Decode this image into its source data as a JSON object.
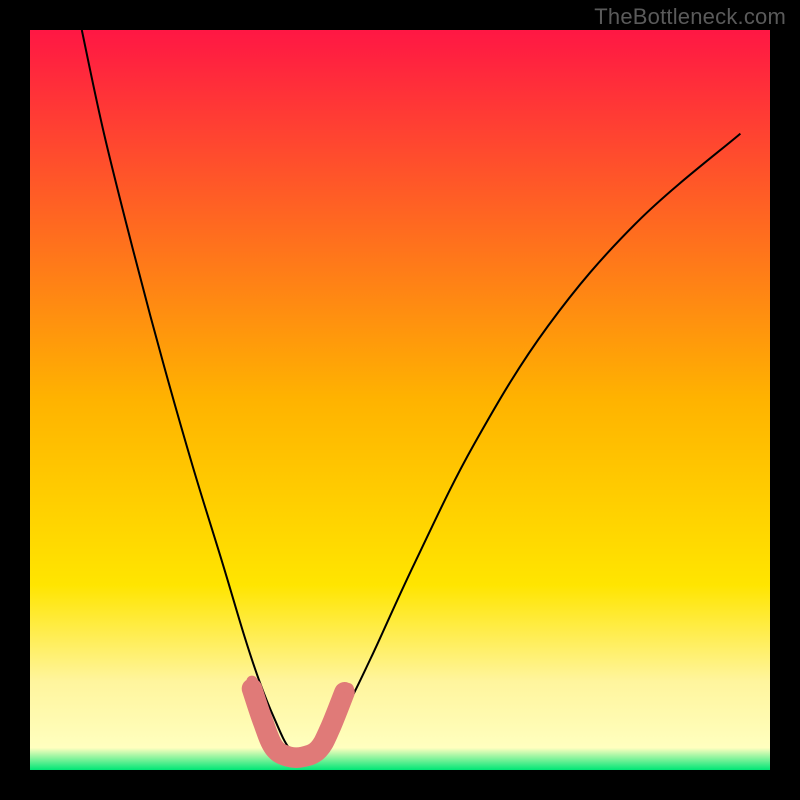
{
  "watermark": "TheBottleneck.com",
  "chart_data": {
    "type": "line",
    "title": "",
    "xlabel": "",
    "ylabel": "",
    "xlim": [
      0,
      100
    ],
    "ylim": [
      0,
      100
    ],
    "grid": false,
    "legend": false,
    "background": {
      "type": "vertical-gradient",
      "stops": [
        {
          "pos": 0.0,
          "color": "#ff1744"
        },
        {
          "pos": 0.5,
          "color": "#ffb300"
        },
        {
          "pos": 0.75,
          "color": "#ffe500"
        },
        {
          "pos": 0.88,
          "color": "#fff59d"
        },
        {
          "pos": 0.97,
          "color": "#ffffbf"
        },
        {
          "pos": 1.0,
          "color": "#00e676"
        }
      ]
    },
    "series": [
      {
        "name": "bottleneck-curve",
        "color": "#000000",
        "width": 2,
        "x": [
          7,
          10,
          14,
          18,
          22,
          26,
          29,
          31,
          33,
          35,
          37,
          39,
          42,
          46,
          52,
          60,
          70,
          82,
          96
        ],
        "values": [
          100,
          86,
          70,
          55,
          41,
          28,
          18,
          12,
          7,
          3,
          2,
          3,
          7,
          15,
          28,
          44,
          60,
          74,
          86
        ]
      },
      {
        "name": "threshold-highlight",
        "color": "#e07a78",
        "width": 10,
        "x": [
          30,
          31.5,
          33,
          35,
          37,
          39,
          40.5,
          42.5
        ],
        "values": [
          11,
          6.5,
          3.0,
          1.8,
          1.8,
          2.8,
          5.5,
          10.5
        ]
      }
    ],
    "markers": [
      {
        "name": "left-dot",
        "x": 30.0,
        "y": 12.0,
        "r": 4,
        "color": "#e07a78"
      },
      {
        "name": "right-dot",
        "x": 43.0,
        "y": 11.0,
        "r": 4,
        "color": "#e07a78"
      }
    ]
  }
}
